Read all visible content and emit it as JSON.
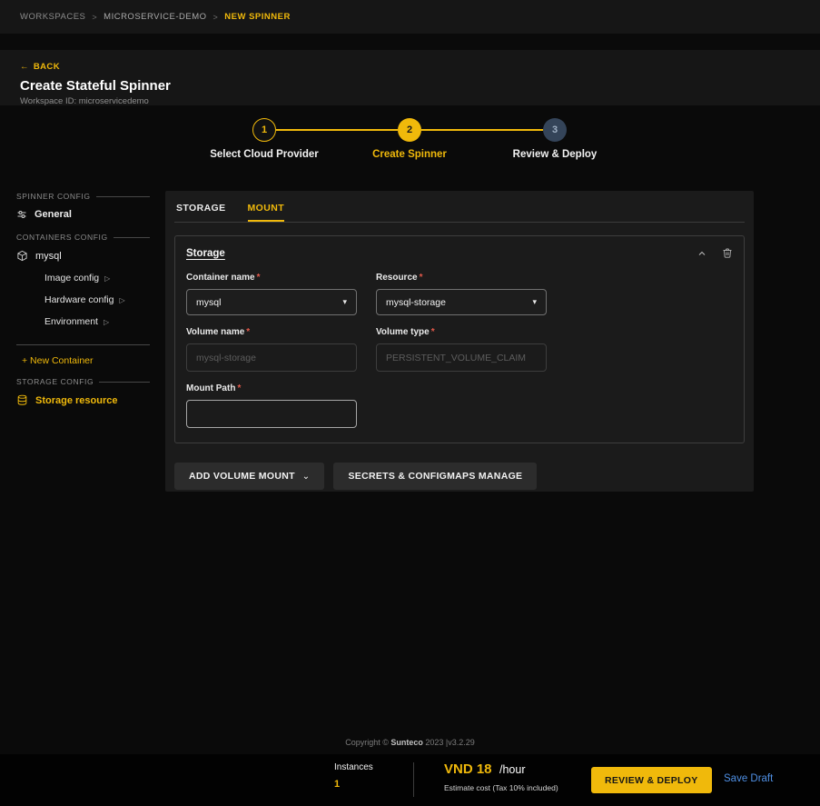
{
  "colors": {
    "accent": "#f0b90b",
    "link": "#4f8fe3",
    "required": "#e2594a"
  },
  "icons": {
    "back_arrow": "←",
    "separator": ">",
    "expand_right": "▷",
    "select_caret": "▾",
    "button_caret": "⌄"
  },
  "breadcrumb": {
    "workspaces": "WORKSPACES",
    "project": "MICROSERVICE-DEMO",
    "current": "NEW SPINNER"
  },
  "header": {
    "back": "BACK",
    "title": "Create Stateful Spinner",
    "workspace_id": "Workspace ID: microservicedemo"
  },
  "stepper": {
    "step1": {
      "num": "1",
      "label": "Select Cloud Provider"
    },
    "step2": {
      "num": "2",
      "label": "Create Spinner"
    },
    "step3": {
      "num": "3",
      "label": "Review & Deploy"
    }
  },
  "sidebar": {
    "spinner_config": "SPINNER CONFIG",
    "general": "General",
    "containers_config": "CONTAINERS CONFIG",
    "container": "mysql",
    "image_config": "Image config",
    "hardware_config": "Hardware config",
    "environment": "Environment",
    "new_container": "+ New Container",
    "storage_config": "STORAGE CONFIG",
    "storage_resource": "Storage resource"
  },
  "panel": {
    "tab_storage": "STORAGE",
    "tab_mount": "MOUNT",
    "section_title": "Storage",
    "required_marker": "*",
    "container_name_label": "Container name",
    "container_name_value": "mysql",
    "resource_label": "Resource",
    "resource_value": "mysql-storage",
    "volume_name_label": "Volume name",
    "volume_name_placeholder": "mysql-storage",
    "volume_type_label": "Volume type",
    "volume_type_placeholder": "PERSISTENT_VOLUME_CLAIM",
    "mount_path_label": "Mount Path",
    "add_volume_mount": "ADD VOLUME MOUNT",
    "secrets_manage": "SECRETS & CONFIGMAPS MANAGE"
  },
  "footer": {
    "copyright": "Copyright ©",
    "brand": "Sunteco",
    "suffix": "2023 |v3.2.29"
  },
  "bottom_bar": {
    "instances_label": "Instances",
    "instances_value": "1",
    "price": "VND 18",
    "unit": "/hour",
    "note": "Estimate cost (Tax 10% included)",
    "review_deploy": "REVIEW & DEPLOY",
    "save_draft": "Save Draft"
  }
}
